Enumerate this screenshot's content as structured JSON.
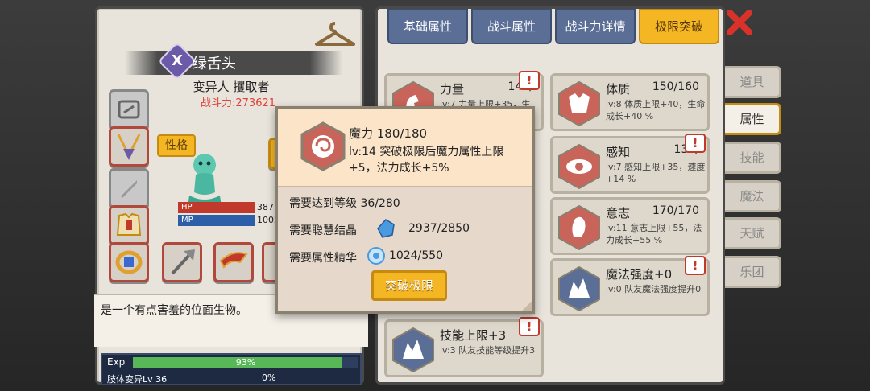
{
  "character": {
    "class_glyph": "X",
    "name": "绿舌头",
    "subtitle": "变异人 攫取者",
    "power": "战斗力:273621",
    "trait_button": "性格",
    "hp_label": "HP",
    "hp_value": "3871",
    "mp_label": "MP",
    "mp_value": "1002",
    "description": "是一个有点害羞的位面生物。",
    "exp_label": "Exp",
    "exp_percent": "93%",
    "exp_fraction": 0.93,
    "skill_label": "肢体变异Lv 36",
    "skill_percent": "0%"
  },
  "tabs": [
    {
      "label": "基础属性",
      "active": false
    },
    {
      "label": "战斗属性",
      "active": false
    },
    {
      "label": "战斗力详情",
      "active": false
    },
    {
      "label": "极限突破",
      "active": true
    }
  ],
  "side_tabs": [
    {
      "label": "道具",
      "active": false
    },
    {
      "label": "属性",
      "active": true
    },
    {
      "label": "技能",
      "active": false
    },
    {
      "label": "魔法",
      "active": false
    },
    {
      "label": "天赋",
      "active": false
    },
    {
      "label": "乐团",
      "active": false
    }
  ],
  "cards": [
    {
      "title": "力量",
      "value": "144/",
      "desc": "lv:7 力量上限+35，生",
      "alert": "!"
    },
    {
      "title": "体质",
      "value": "150/160",
      "desc": "lv:8 体质上限+40，生命成长+40 %",
      "alert": "!"
    },
    {
      "title": "感知",
      "value": "133/",
      "desc": "lv:7 感知上限+35，速度+14 %",
      "alert": "!"
    },
    {
      "title": "意志",
      "value": "170/170",
      "desc": "lv:11 意志上限+55，法力成长+55 %",
      "alert": ""
    },
    {
      "title": "魔法强度+0",
      "value": "",
      "desc": "lv:0 队友魔法强度提升0",
      "alert": "!"
    },
    {
      "title": "技能上限+3",
      "value": "",
      "desc": "lv:3 队友技能等级提升3",
      "alert": "!"
    }
  ],
  "popup": {
    "title": "魔力 180/180",
    "desc": "lv:14 突破极限后魔力属性上限+5，法力成长+5%",
    "req_level": "需要达到等级 36/280",
    "req_crystal_label": "需要聪慧结晶",
    "req_crystal_value": "2937/2850",
    "req_essence_label": "需要属性精华",
    "req_essence_value": "1024/550",
    "button": "突破极限"
  },
  "colors": {
    "accent_gold": "#f4b622",
    "tab_blue": "#5a6e96",
    "alert_red": "#c0392b",
    "power_red": "#e0413a"
  }
}
